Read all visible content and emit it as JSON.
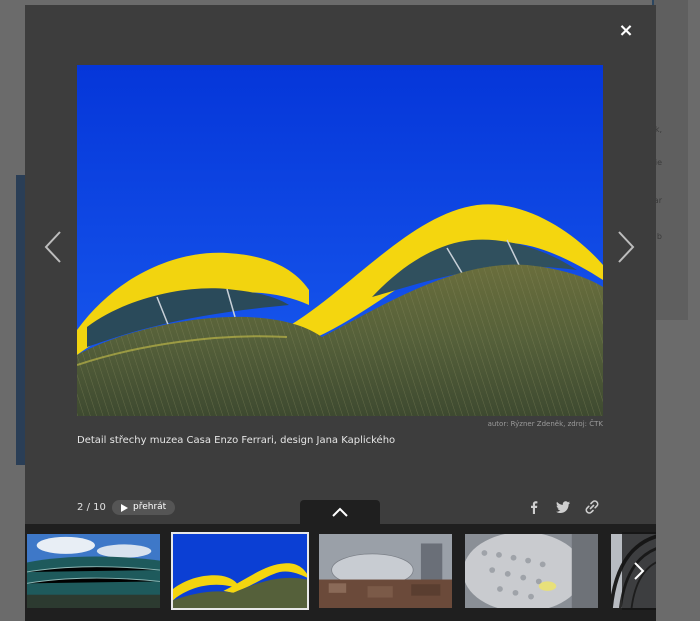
{
  "gallery": {
    "caption": "Detail střechy muzea Casa Enzo Ferrari, design Jana Kaplického",
    "credit": "autor: Rýzner Zdeněk, zdroj: ČTK",
    "current": "2",
    "total": "10",
    "counter_sep": "/",
    "play_label": "přehrát",
    "close_label": "×"
  },
  "icons": {
    "close": "close-icon",
    "prev": "chevron-left-icon",
    "next": "chevron-right-icon",
    "play": "play-icon",
    "facebook": "facebook-icon",
    "twitter": "twitter-icon",
    "link": "link-icon",
    "toggle": "chevron-up-icon"
  },
  "thumbnails": [
    {
      "subject": "green-glass-building-under-sky",
      "active": false
    },
    {
      "subject": "yellow-roof-casa-enzo-ferrari",
      "active": true
    },
    {
      "subject": "silver-disc-building-street",
      "active": false
    },
    {
      "subject": "silver-disc-facade-closeup",
      "active": false
    },
    {
      "subject": "curved-steel-arches",
      "active": false
    }
  ],
  "background_page": {
    "right_snippets": [
      "k,",
      "die",
      "ar",
      "b"
    ]
  },
  "colors": {
    "modal_bg": "#3d3d3d",
    "strip_bg": "#1f1f1f",
    "sky_blue": "#0b3fd4",
    "roof_yellow": "#f2d40f"
  }
}
